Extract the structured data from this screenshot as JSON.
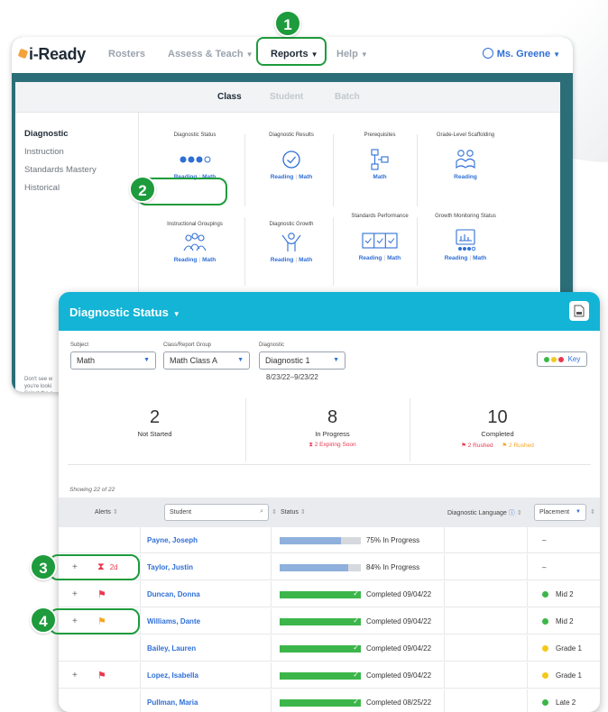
{
  "colors": {
    "teal_dark": "#2c6e78",
    "header_blue": "#13b4d6",
    "link_blue": "#2f6fd6",
    "callout_green": "#1e9b3c",
    "completed_green": "#3cb64a",
    "progress_blue": "#8fb0dc",
    "rushed_red": "#e8384f",
    "rushed_orange": "#f5a623",
    "placement_green": "#3cb64a",
    "placement_yellow": "#f4c81c"
  },
  "callouts": [
    "1",
    "2",
    "3",
    "4"
  ],
  "topnav": {
    "logo": "i-Ready",
    "items": [
      "Rosters",
      "Assess & Teach",
      "Reports",
      "Help"
    ],
    "user": "Ms. Greene"
  },
  "subtabs": [
    "Class",
    "Student",
    "Batch"
  ],
  "leftnav": [
    "Diagnostic",
    "Instruction",
    "Standards Mastery",
    "Historical"
  ],
  "leftnote": "Don't see w you're looki Select the c and grades",
  "tiles": [
    {
      "title": "Diagnostic Status",
      "icon": "dots-icon",
      "links": [
        "Reading",
        "Math"
      ]
    },
    {
      "title": "Diagnostic Results",
      "icon": "check-circle-icon",
      "links": [
        "Reading",
        "Math"
      ]
    },
    {
      "title": "Prerequisites",
      "icon": "flowchart-icon",
      "links": [
        "Math"
      ]
    },
    {
      "title": "Grade-Level Scaffolding",
      "icon": "reading-people-icon",
      "links": [
        "Reading"
      ]
    },
    {
      "title": "Instructional Groupings",
      "icon": "group-icon",
      "links": [
        "Reading",
        "Math"
      ]
    },
    {
      "title": "Diagnostic Growth",
      "icon": "growth-person-icon",
      "links": [
        "Reading",
        "Math"
      ]
    },
    {
      "title": "Standards Performance",
      "icon": "checkboxes-icon",
      "links": [
        "Reading",
        "Math"
      ]
    },
    {
      "title": "Growth Monitoring Status",
      "icon": "chart-monitor-icon",
      "links": [
        "Reading",
        "Math"
      ]
    }
  ],
  "panel": {
    "title": "Diagnostic Status",
    "filters": {
      "subject_label": "Subject",
      "subject_value": "Math",
      "class_label": "Class/Report Group",
      "class_value": "Math Class A",
      "diag_label": "Diagnostic",
      "diag_value": "Diagnostic 1",
      "date_range": "8/23/22–9/23/22"
    },
    "key_label": "Key",
    "summary": [
      {
        "num": "2",
        "label": "Not Started",
        "sub": ""
      },
      {
        "num": "8",
        "label": "In Progress",
        "sub": "2 Expiring Soon"
      },
      {
        "num": "10",
        "label": "Completed",
        "sub_red": "2 Rushed",
        "sub_orange": "2 Rushed"
      }
    ],
    "showing": "Showing 22 of 22",
    "headers": {
      "alerts": "Alerts",
      "student": "Student",
      "status": "Status",
      "language": "Diagnostic Language",
      "placement": "Placement"
    },
    "rows": [
      {
        "plus": "",
        "alert": "",
        "alert_text": "",
        "name": "Payne, Joseph",
        "progress": 0.75,
        "status_kind": "progress",
        "status": "75% In Progress",
        "placement": "–",
        "placement_color": ""
      },
      {
        "plus": "+",
        "alert": "hourglass",
        "alert_text": "2d",
        "name": "Taylor, Justin",
        "progress": 0.84,
        "status_kind": "progress",
        "status": "84% In Progress",
        "placement": "–",
        "placement_color": ""
      },
      {
        "plus": "+",
        "alert": "flag-red",
        "alert_text": "",
        "name": "Duncan, Donna",
        "progress": 1,
        "status_kind": "complete",
        "status": "Completed 09/04/22",
        "placement": "Mid 2",
        "placement_color": "#3cb64a"
      },
      {
        "plus": "+",
        "alert": "flag-orange",
        "alert_text": "",
        "name": "Williams, Dante",
        "progress": 1,
        "status_kind": "complete",
        "status": "Completed 09/04/22",
        "placement": "Mid 2",
        "placement_color": "#3cb64a"
      },
      {
        "plus": "",
        "alert": "",
        "alert_text": "",
        "name": "Bailey, Lauren",
        "progress": 1,
        "status_kind": "complete",
        "status": "Completed 09/04/22",
        "placement": "Grade 1",
        "placement_color": "#f4c81c"
      },
      {
        "plus": "+",
        "alert": "flag-red",
        "alert_text": "",
        "name": "Lopez, Isabella",
        "progress": 1,
        "status_kind": "complete",
        "status": "Completed 09/04/22",
        "placement": "Grade 1",
        "placement_color": "#f4c81c"
      },
      {
        "plus": "",
        "alert": "",
        "alert_text": "",
        "name": "Pullman, Maria",
        "progress": 1,
        "status_kind": "complete",
        "status": "Completed 08/25/22",
        "placement": "Late 2",
        "placement_color": "#3cb64a"
      }
    ]
  }
}
